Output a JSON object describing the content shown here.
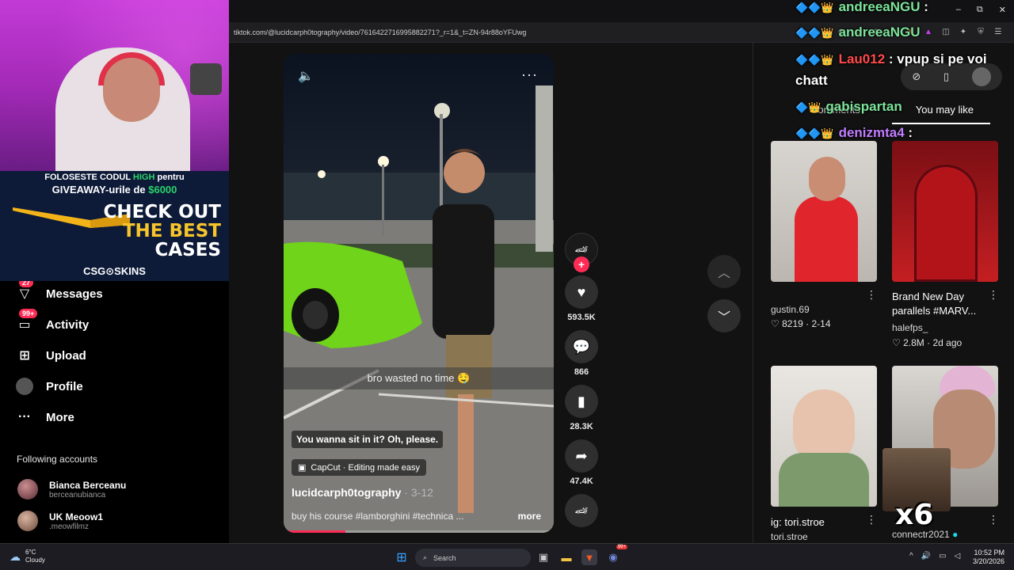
{
  "browser": {
    "url": "tiktok.com/@lucidcarph0tography/video/7616422716995882271?_r=1&_t=ZN-94r88oYFUwg",
    "minimize": "–",
    "maximize": "⧉",
    "close": "✕"
  },
  "promo": {
    "line1_a": "FOLOSESTE CODUL ",
    "line1_code": "HIGH",
    "line1_b": " pentru",
    "line2_a": "GIVEAWAY-urile de ",
    "line2_amount": "$6000",
    "check": "CHECK OUT",
    "best": "THE BEST",
    "cases": "CASES",
    "brand": "CSG⊙SKINS"
  },
  "sidebar": {
    "items": [
      {
        "label": "Messages",
        "badge": "27"
      },
      {
        "label": "Activity",
        "badge": "99+"
      },
      {
        "label": "Upload",
        "badge": ""
      },
      {
        "label": "Profile",
        "badge": ""
      },
      {
        "label": "More",
        "badge": ""
      }
    ],
    "following_title": "Following accounts",
    "accounts": [
      {
        "name": "Bianca Berceanu",
        "handle": "berceanubianca"
      },
      {
        "name": "UK Meoow1",
        "handle": ".meowfilmz"
      }
    ]
  },
  "video": {
    "caption": "bro wasted no time 🤤",
    "quote": "You wanna sit in it? Oh, please.",
    "capcut": "CapCut · Editing made easy",
    "author": "lucidcarph0tography",
    "date": " · 3-12",
    "description": "buy his course #lamborghini #technica ...",
    "more": "more",
    "progress": 0.23
  },
  "actions": {
    "likes": "593.5K",
    "comments": "866",
    "saves": "28.3K",
    "shares": "47.4K"
  },
  "right_panel": {
    "tab_comments": "Comments",
    "tab_you_may_like": "You may like",
    "cards": [
      {
        "title": "",
        "user": "gustin.69",
        "likes": "8219",
        "date": "2-14"
      },
      {
        "title": "Brand New Day parallels #MARV...",
        "user": "halefps_",
        "likes": "2.8M",
        "date": "2d ago"
      },
      {
        "title": "ig: tori.stroe",
        "user": "tori.stroe",
        "likes": "",
        "date": ""
      },
      {
        "title": "",
        "user": "connectr2021",
        "likes": "",
        "date": ""
      }
    ]
  },
  "chat": [
    {
      "user": "andreeaNGU",
      "msg": " :",
      "color": "#7de39a"
    },
    {
      "user": "andreeaNGU",
      "msg": "",
      "color": "#7de39a"
    },
    {
      "user": "Lau012",
      "msg": " : vpup si pe voi",
      "color": "#ff4a4a"
    },
    {
      "user": "",
      "msg": "chatt",
      "color": "#fff"
    },
    {
      "user": "gabispartan",
      "msg": "",
      "color": "#7de39a"
    },
    {
      "user": "denizmta4",
      "msg": " :",
      "color": "#c07dff"
    }
  ],
  "overlay": {
    "multiplier": "x6"
  },
  "taskbar": {
    "temp": "6°C",
    "weather": "Cloudy",
    "search": "Search",
    "time": "10:52 PM",
    "date": "3/20/2026",
    "notif": "99+"
  },
  "colors": {
    "accent": "#fe2c55",
    "panel": "#121212"
  }
}
